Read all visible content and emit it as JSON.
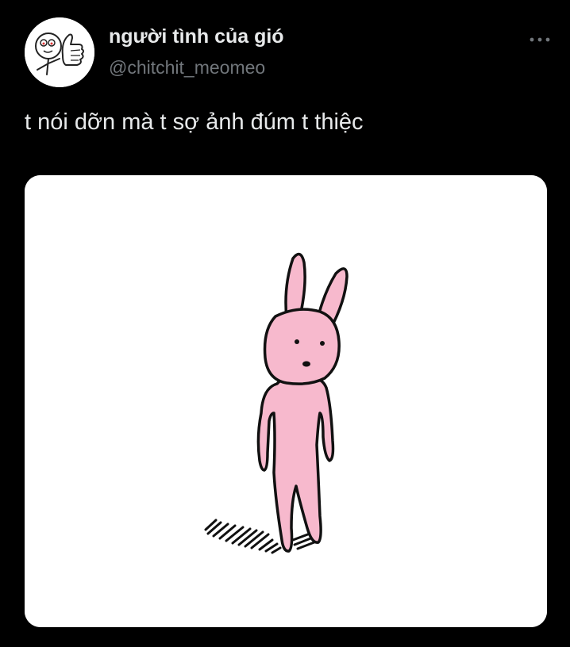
{
  "tweet": {
    "author": {
      "display_name": "người tình của gió",
      "handle": "@chitchit_meomeo",
      "avatar_icon": "thumbs-up-doodle-avatar"
    },
    "more_icon": "more-horizontal-icon",
    "text": "t nói dỡn mà t sợ ảnh đúm t thiệc",
    "media": {
      "kind": "image",
      "subject": "pink-bunny-drawing",
      "colors": {
        "bunny_fill": "#f7b9cd",
        "outline": "#111111",
        "background": "#ffffff"
      }
    }
  },
  "theme": {
    "background": "#000000",
    "text_primary": "#e7e9ea",
    "text_secondary": "#71767b"
  }
}
